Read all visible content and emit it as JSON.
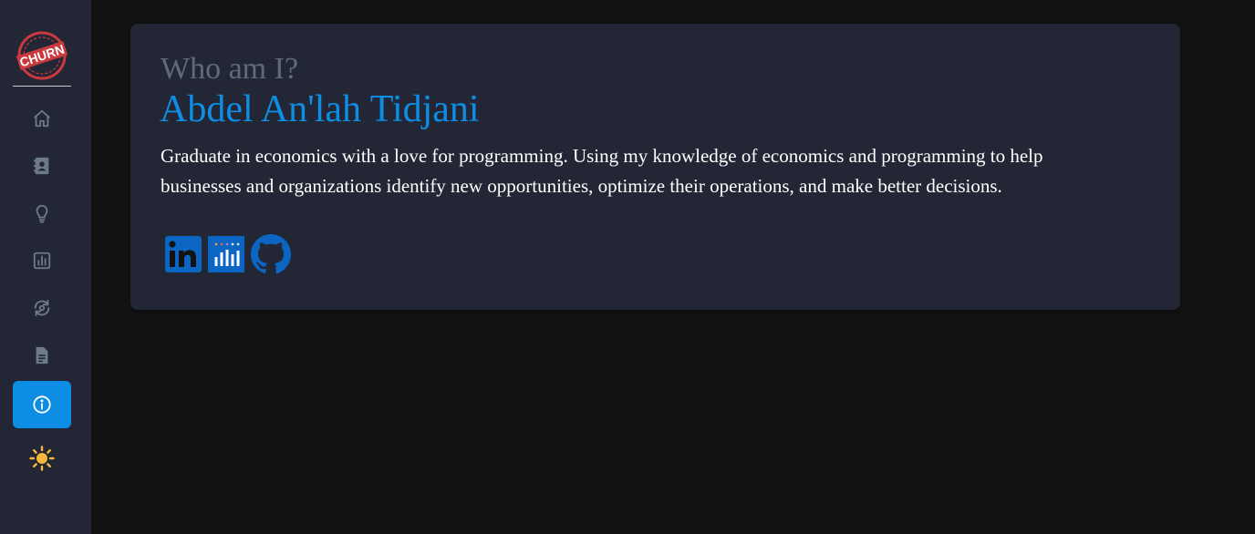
{
  "sidebar": {
    "logo_text": "CHURN",
    "items": [
      {
        "name": "home-icon"
      },
      {
        "name": "contact-book-icon"
      },
      {
        "name": "lightbulb-icon"
      },
      {
        "name": "bar-chart-icon"
      },
      {
        "name": "refresh-eye-icon"
      },
      {
        "name": "document-icon"
      },
      {
        "name": "info-icon",
        "active": true
      }
    ],
    "theme_icon": "sun-icon"
  },
  "about": {
    "eyebrow": "Who am I?",
    "name": "Abdel An'lah Tidjani",
    "bio": "Graduate in economics with a love for programming. Using my knowledge of economics and programming to help businesses and organizations identify new opportunities, optimize their operations, and make better decisions."
  },
  "socials": [
    {
      "icon": "linkedin-icon"
    },
    {
      "icon": "tableau-icon"
    },
    {
      "icon": "github-icon"
    }
  ],
  "colors": {
    "background": "#121213",
    "panel": "#232634",
    "accent": "#0d8ee4",
    "muted_text": "#5e6b7d",
    "icon_gray": "#6c7a8c",
    "sun": "#f7b93b",
    "logo_red": "#c9393d"
  }
}
